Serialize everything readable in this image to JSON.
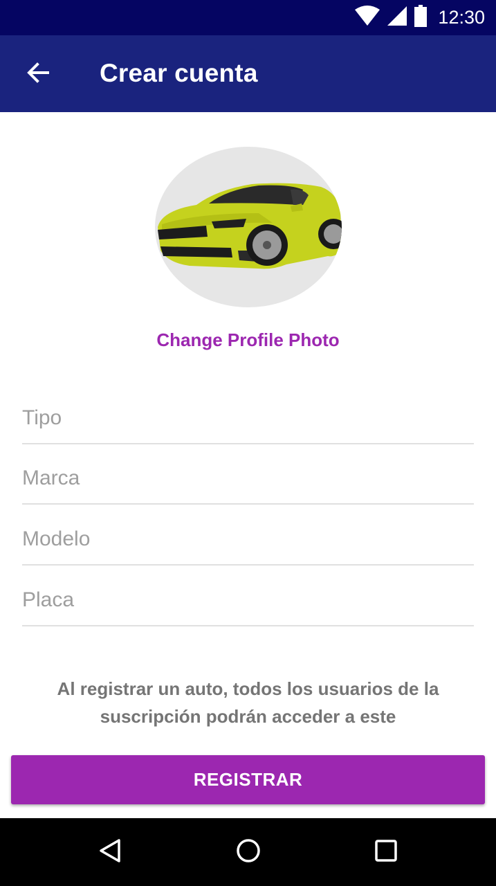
{
  "status_bar": {
    "time": "12:30",
    "icons": [
      "wifi-icon",
      "signal-icon",
      "battery-icon"
    ]
  },
  "app_bar": {
    "title": "Crear cuenta",
    "back_icon": "arrow-back-icon"
  },
  "profile": {
    "image": "car-photo",
    "change_photo_label": "Change Profile Photo"
  },
  "form": {
    "fields": [
      {
        "name": "tipo",
        "placeholder": "Tipo",
        "value": ""
      },
      {
        "name": "marca",
        "placeholder": "Marca",
        "value": ""
      },
      {
        "name": "modelo",
        "placeholder": "Modelo",
        "value": ""
      },
      {
        "name": "placa",
        "placeholder": "Placa",
        "value": ""
      }
    ]
  },
  "info_text": "Al registrar un auto, todos los usuarios de la suscripción podrán acceder a este",
  "register_button": "REGISTRAR",
  "nav_bar": {
    "buttons": [
      "nav-back-icon",
      "nav-home-icon",
      "nav-recent-icon"
    ]
  },
  "colors": {
    "status_bar": "#050562",
    "app_bar": "#1a237e",
    "accent": "#9c27b0",
    "car": "#c5d21e"
  }
}
